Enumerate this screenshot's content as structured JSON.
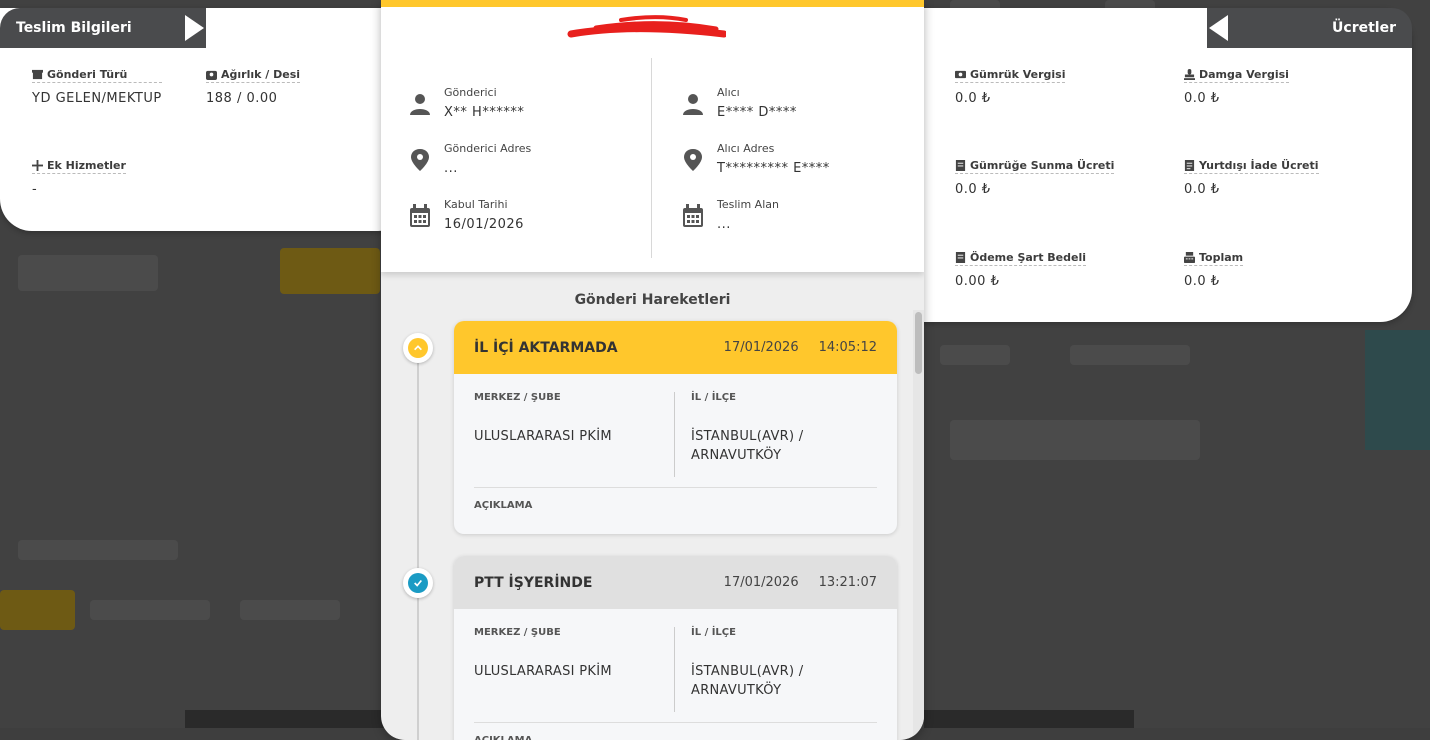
{
  "left_panel": {
    "tab_title": "Teslim Bilgileri",
    "fields": {
      "shipment_type": {
        "label": "Gönderi Türü",
        "value": "YD GELEN/MEKTUP"
      },
      "weight": {
        "label": "Ağırlık / Desi",
        "value": "188 / 0.00"
      },
      "extra_services": {
        "label": "Ek Hizmetler",
        "value": "-"
      }
    }
  },
  "right_panel": {
    "tab_title": "Ücretler",
    "fields": {
      "customs_tax": {
        "label": "Gümrük Vergisi",
        "value": "0.0 ₺"
      },
      "stamp_tax": {
        "label": "Damga Vergisi",
        "value": "0.0 ₺"
      },
      "customs_presentation": {
        "label": "Gümrüğe Sunma Ücreti",
        "value": "0.0 ₺"
      },
      "abroad_return": {
        "label": "Yurtdışı İade Ücreti",
        "value": "0.0 ₺"
      },
      "payment_condition": {
        "label": "Ödeme Şart Bedeli",
        "value": "0.00 ₺"
      },
      "total": {
        "label": "Toplam",
        "value": "0.0 ₺"
      }
    }
  },
  "modal": {
    "sender": {
      "label": "Gönderici",
      "value": "X** H******"
    },
    "sender_address": {
      "label": "Gönderici Adres",
      "value": "..."
    },
    "acceptance_date": {
      "label": "Kabul Tarihi",
      "value": "16/01/2026"
    },
    "receiver": {
      "label": "Alıcı",
      "value": "E**** D****"
    },
    "receiver_address": {
      "label": "Alıcı Adres",
      "value": "T********* E****"
    },
    "delivered_to": {
      "label": "Teslim Alan",
      "value": "..."
    },
    "movements_title": "Gönderi Hareketleri",
    "movements": [
      {
        "status": "İL İÇİ AKTARMADA",
        "date": "17/01/2026",
        "time": "14:05:12",
        "center_label": "MERKEZ / ŞUBE",
        "center_value": "ULUSLARARASI PKİM",
        "city_label": "İL / İLÇE",
        "city_value_line1": "İSTANBUL(AVR) /",
        "city_value_line2": "ARNAVUTKÖY",
        "desc_label": "AÇIKLAMA",
        "header_color": "#ffc72c",
        "icon": "chevron-up-icon"
      },
      {
        "status": "PTT İŞYERİNDE",
        "date": "17/01/2026",
        "time": "13:21:07",
        "center_label": "MERKEZ / ŞUBE",
        "center_value": "ULUSLARARASI PKİM",
        "city_label": "İL / İLÇE",
        "city_value_line1": "İSTANBUL(AVR) /",
        "city_value_line2": "ARNAVUTKÖY",
        "desc_label": "AÇIKLAMA",
        "header_color": "#e0e0e0",
        "icon": "check-icon"
      }
    ]
  },
  "colors": {
    "accent": "#ffc72c",
    "tab_bg": "#4a4b4d",
    "check_blue": "#1a9bc4"
  }
}
